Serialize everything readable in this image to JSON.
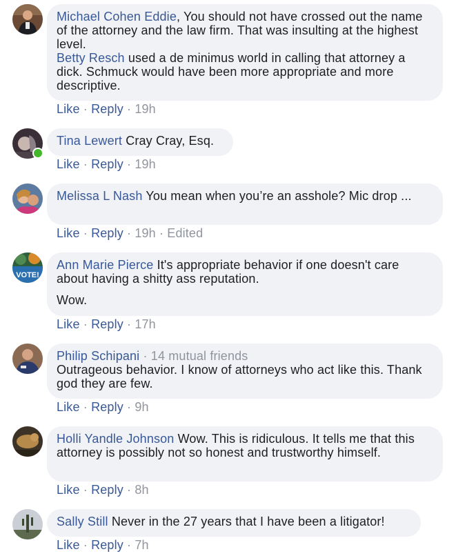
{
  "comments": [
    {
      "author": "Michael Cohen",
      "paragraphs": [
        {
          "mention": "Eddie",
          "text": ", You should not have crossed out the name of the attorney and the law firm. That was insulting at the highest level."
        },
        {
          "mention": "Betty Resch",
          "text": " used a de minimus world in calling that attorney a dick. Schmuck would have been more appropriate and more descriptive."
        }
      ],
      "like": "Like",
      "reply": "Reply",
      "time": "19h"
    },
    {
      "author": "Tina Lewert",
      "text": "Cray Cray, Esq.",
      "like": "Like",
      "reply": "Reply",
      "time": "19h"
    },
    {
      "author": "Melissa L Nash",
      "text": "You mean when you’re an asshole? Mic drop ...",
      "like": "Like",
      "reply": "Reply",
      "time": "19h",
      "edited": "Edited"
    },
    {
      "author": "Ann Marie Pierce",
      "text": "It's appropriate behavior if one doesn't care about having a shitty ass reputation.",
      "text2": "Wow.",
      "like": "Like",
      "reply": "Reply",
      "time": "17h"
    },
    {
      "author": "Philip Schipani",
      "mutual": "14 mutual friends",
      "text": "Outrageous behavior. I know of attorneys who act like this. Thank god they are few.",
      "like": "Like",
      "reply": "Reply",
      "time": "9h"
    },
    {
      "author": "Holli Yandle Johnson",
      "text": "Wow. This is ridiculous. It tells me that this attorney is possibly not so honest and trustworthy himself.",
      "like": "Like",
      "reply": "Reply",
      "time": "8h"
    },
    {
      "author": "Sally Still",
      "text": "Never in the 27 years that I have been a litigator!",
      "like": "Like",
      "reply": "Reply",
      "time": "7h"
    }
  ],
  "separator": "·",
  "avatar_badge_vote": "VOTE!",
  "colors": {
    "link": "#385898",
    "meta": "#90949c",
    "bubble": "#f0f2f5",
    "online": "#42b72a"
  }
}
